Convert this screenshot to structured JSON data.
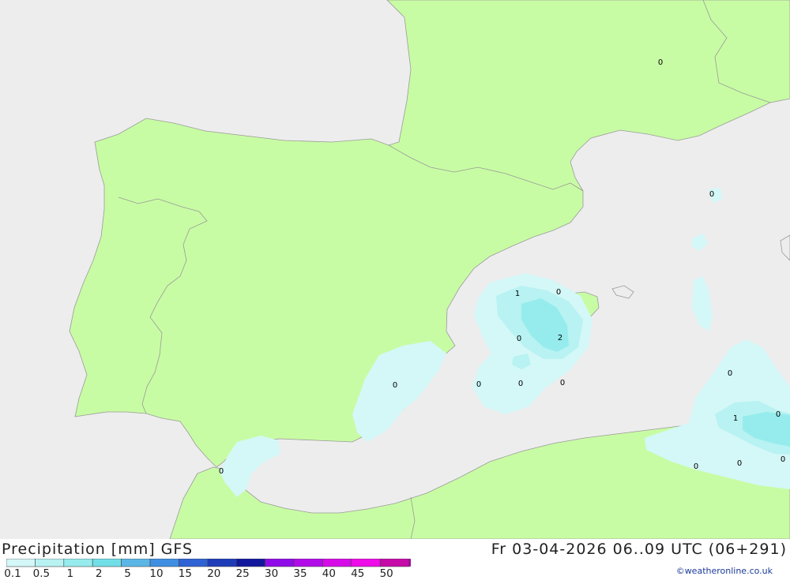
{
  "map": {
    "contour_labels": [
      "0",
      "0",
      "1",
      "0",
      "2",
      "0",
      "0",
      "0",
      "0",
      "0",
      "0",
      "1",
      "0",
      "0",
      "0",
      "0",
      "0"
    ]
  },
  "footer": {
    "title": "Precipitation [mm] GFS",
    "date": "Fr 03-04-2026 06..09 UTC (06+291)",
    "credit": "©weatheronline.co.uk"
  },
  "legend": {
    "labels": [
      "0.1",
      "0.5",
      "1",
      "2",
      "5",
      "10",
      "15",
      "20",
      "25",
      "30",
      "35",
      "40",
      "45",
      "50"
    ],
    "colors": [
      "#d4f7f7",
      "#b8f2f2",
      "#96ecec",
      "#71dfe8",
      "#5bb6e6",
      "#3f8ee2",
      "#2f62d4",
      "#1f3cb8",
      "#12189c",
      "#8f0ce8",
      "#b10ce8",
      "#d50ce8",
      "#ee0ce8",
      "#c50aa8"
    ]
  }
}
